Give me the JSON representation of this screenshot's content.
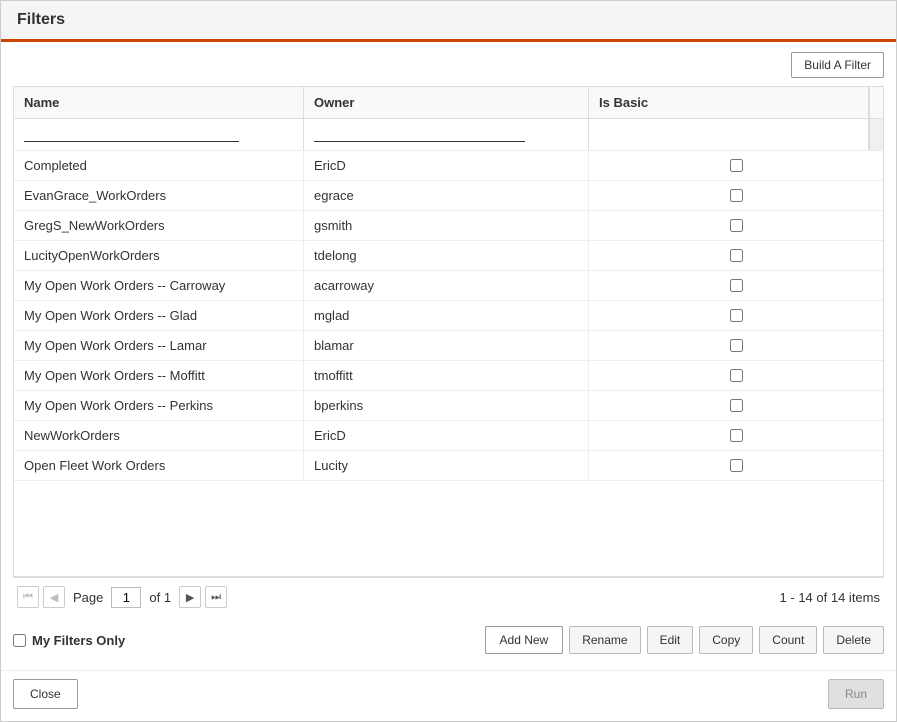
{
  "dialog": {
    "title": "Filters"
  },
  "toolbar": {
    "build_filter_label": "Build A Filter"
  },
  "table": {
    "columns": [
      {
        "key": "name",
        "label": "Name"
      },
      {
        "key": "owner",
        "label": "Owner"
      },
      {
        "key": "is_basic",
        "label": "Is Basic"
      }
    ],
    "filter_placeholders": {
      "name": "",
      "owner": ""
    },
    "rows": [
      {
        "name": "Completed",
        "owner": "EricD",
        "is_basic": false
      },
      {
        "name": "EvanGrace_WorkOrders",
        "owner": "egrace",
        "is_basic": false
      },
      {
        "name": "GregS_NewWorkOrders",
        "owner": "gsmith",
        "is_basic": false
      },
      {
        "name": "LucityOpenWorkOrders",
        "owner": "tdelong",
        "is_basic": false
      },
      {
        "name": "My Open Work Orders -- Carroway",
        "owner": "acarroway",
        "is_basic": false
      },
      {
        "name": "My Open Work Orders -- Glad",
        "owner": "mglad",
        "is_basic": false
      },
      {
        "name": "My Open Work Orders -- Lamar",
        "owner": "blamar",
        "is_basic": false
      },
      {
        "name": "My Open Work Orders -- Moffitt",
        "owner": "tmoffitt",
        "is_basic": false
      },
      {
        "name": "My Open Work Orders -- Perkins",
        "owner": "bperkins",
        "is_basic": false
      },
      {
        "name": "NewWorkOrders",
        "owner": "EricD",
        "is_basic": false
      },
      {
        "name": "Open Fleet Work Orders",
        "owner": "Lucity",
        "is_basic": false
      }
    ]
  },
  "pagination": {
    "page_label": "Page",
    "current_page": "1",
    "of_label": "of 1",
    "summary": "1 - 14 of 14 items"
  },
  "my_filters": {
    "label": "My Filters Only"
  },
  "action_buttons": {
    "add_new": "Add New",
    "rename": "Rename",
    "edit": "Edit",
    "copy": "Copy",
    "count": "Count",
    "delete": "Delete"
  },
  "footer": {
    "close": "Close",
    "run": "Run"
  },
  "icons": {
    "first": "⏮",
    "prev": "◀",
    "next": "▶",
    "last": "⏭"
  }
}
